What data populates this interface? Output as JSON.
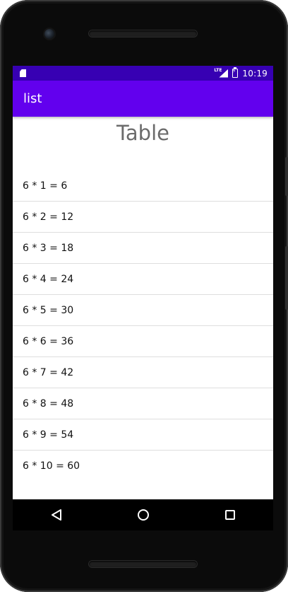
{
  "status_bar": {
    "network_label": "LTE",
    "time": "10:19",
    "icons": [
      "sd-card-icon",
      "lte-signal-icon",
      "battery-charging-icon"
    ]
  },
  "app_bar": {
    "title": "list"
  },
  "page": {
    "title": "Table"
  },
  "list": {
    "items": [
      "6 * 1 = 6",
      "6 * 2 = 12",
      "6 * 3 = 18",
      "6 * 4 = 24",
      "6 * 5 = 30",
      "6 * 6 = 36",
      "6 * 7 = 42",
      "6 * 8 = 48",
      "6 * 9 = 54",
      "6 * 10 = 60"
    ]
  },
  "nav_bar": {
    "icons": [
      "back-icon",
      "home-icon",
      "recents-icon"
    ]
  },
  "colors": {
    "status_bar": "#3700b3",
    "app_bar": "#6200ee",
    "title_text": "#6b6b6b"
  }
}
